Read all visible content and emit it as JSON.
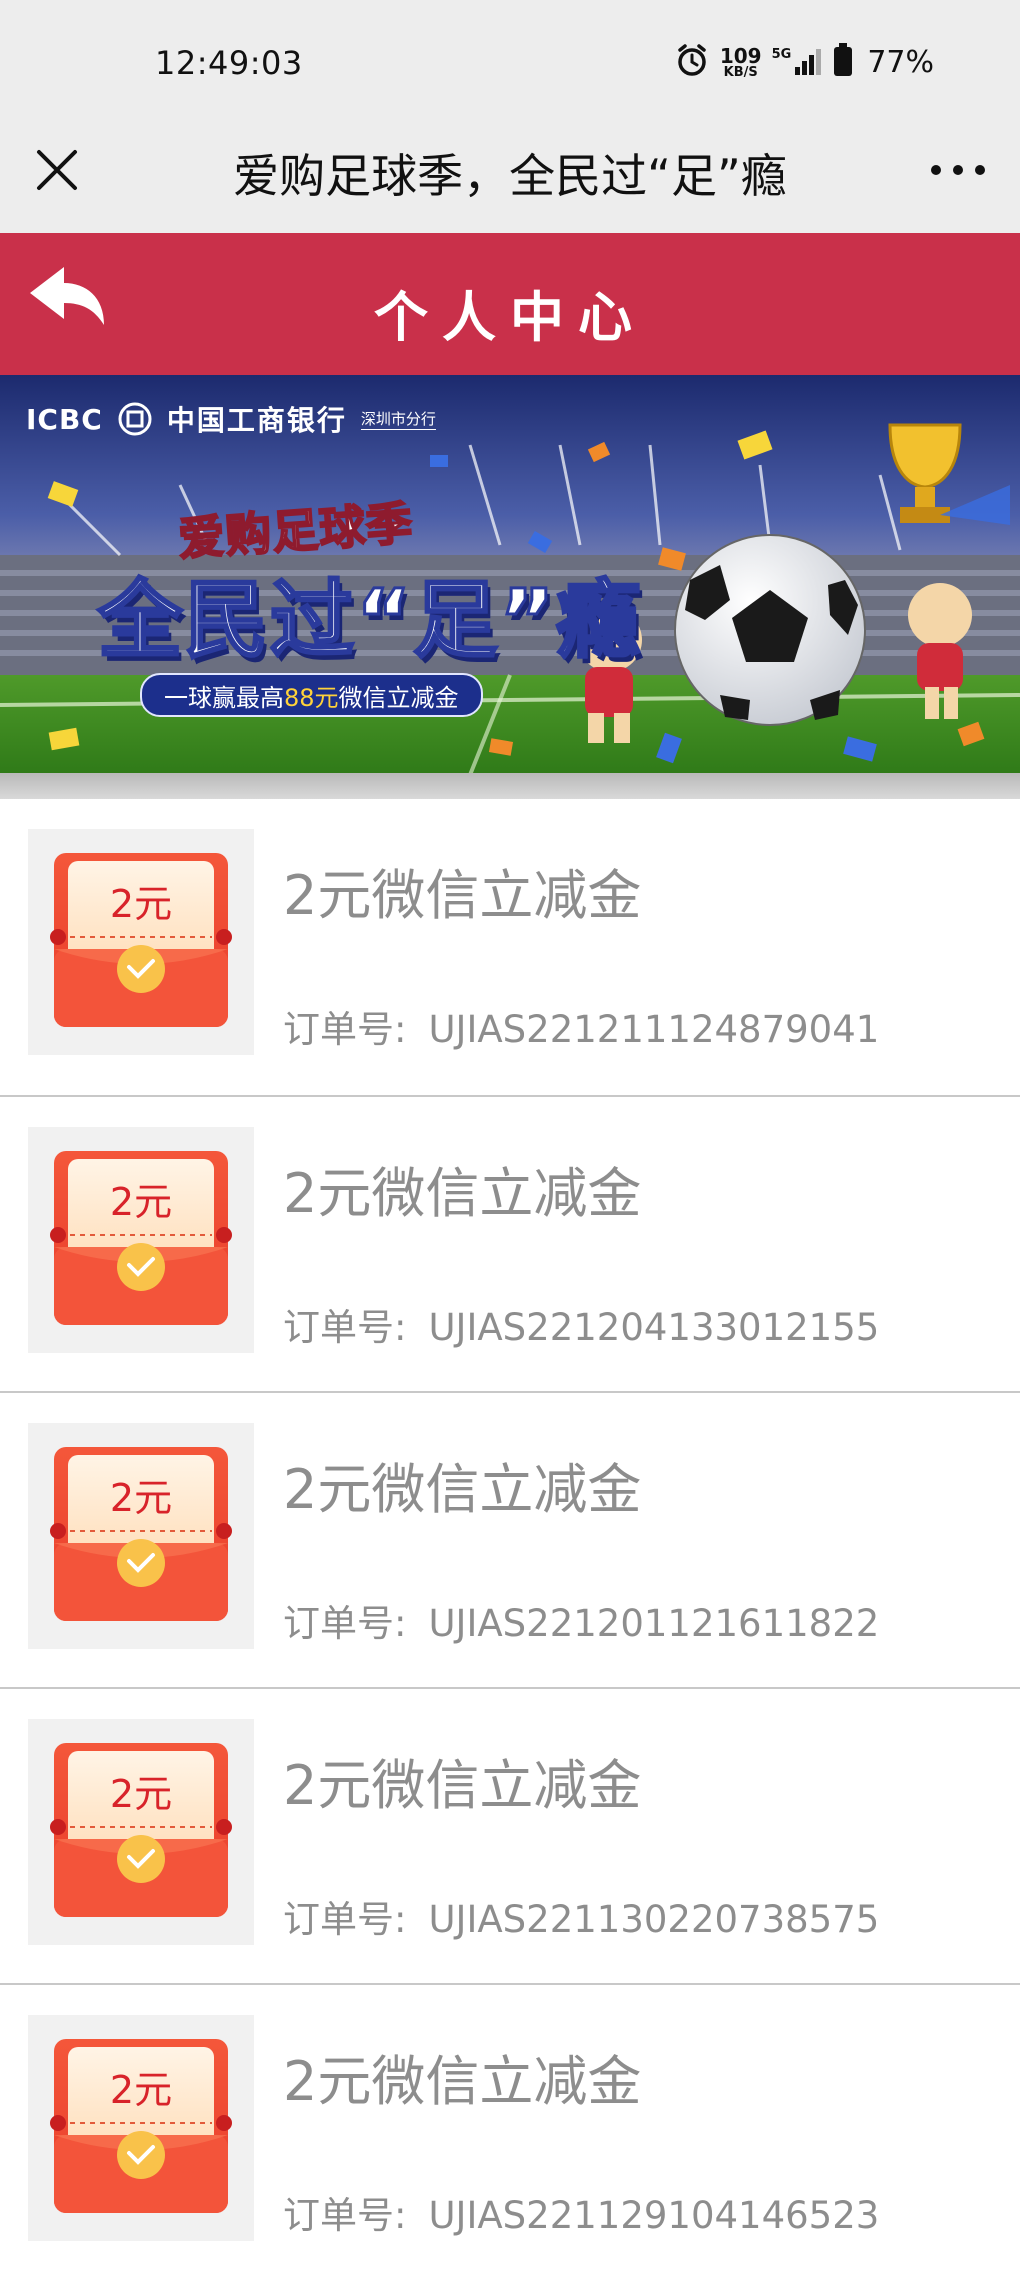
{
  "status_bar": {
    "time": "12:49:03",
    "net_speed": "109",
    "net_unit": "KB/S",
    "network": "5G",
    "battery": "77%"
  },
  "webview": {
    "title": "爱购足球季，全民过“足”瘾",
    "close_icon": "close-icon",
    "more_icon": "more-icon"
  },
  "header": {
    "title": "个人中心",
    "back_icon": "back-arrow-icon",
    "color": "#c9304a"
  },
  "banner": {
    "icbc": "ICBC",
    "bank_name": "中国工商银行",
    "branch": "深圳市分行",
    "slogan_line1": "爱购足球季",
    "slogan_line2": "全民过“足”瘾",
    "slogan_line3_pre": "一球赢最高",
    "slogan_line3_highlight": "88元",
    "slogan_line3_post": "微信立减金"
  },
  "items": [
    {
      "badge": "2元",
      "title": "2元微信立减金",
      "order_label": "订单号:",
      "order_no": "UJIAS221211124879041"
    },
    {
      "badge": "2元",
      "title": "2元微信立减金",
      "order_label": "订单号:",
      "order_no": "UJIAS221204133012155"
    },
    {
      "badge": "2元",
      "title": "2元微信立减金",
      "order_label": "订单号:",
      "order_no": "UJIAS221201121611822"
    },
    {
      "badge": "2元",
      "title": "2元微信立减金",
      "order_label": "订单号:",
      "order_no": "UJIAS221130220738575"
    },
    {
      "badge": "2元",
      "title": "2元微信立减金",
      "order_label": "订单号:",
      "order_no": "UJIAS221129104146523"
    }
  ]
}
